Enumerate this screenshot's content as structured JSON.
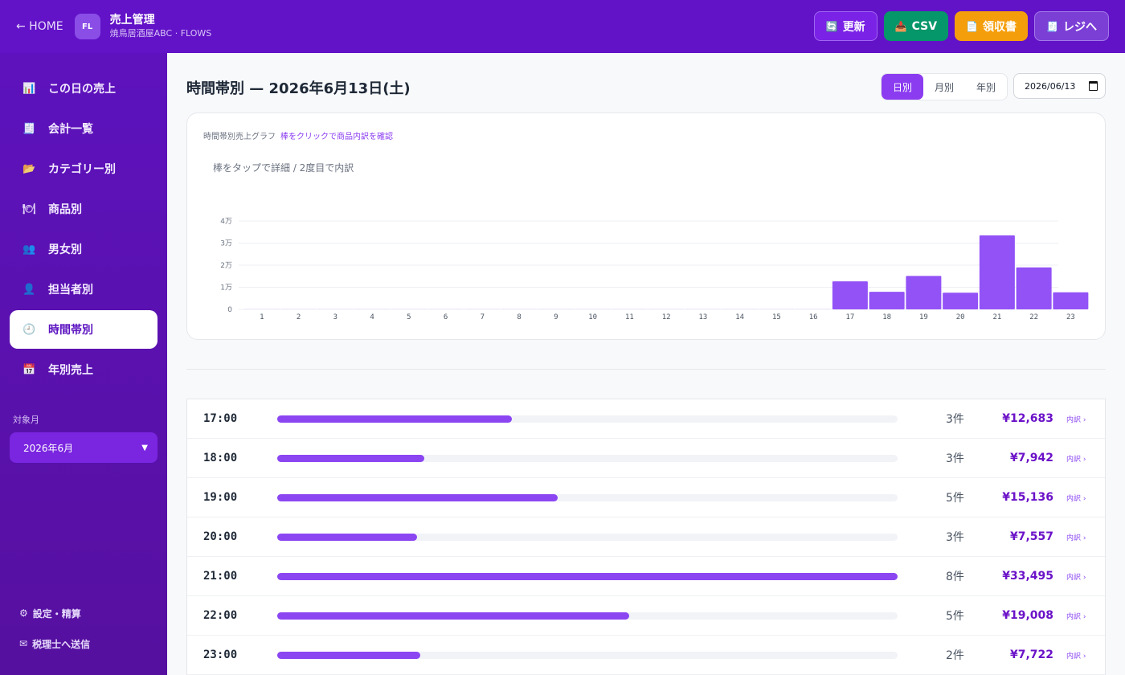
{
  "header": {
    "home_label": "← HOME",
    "logo_text": "FL",
    "title": "売上管理",
    "subtitle": "焼鳥居酒屋ABC · FLOWS",
    "buttons": {
      "refresh": {
        "icon": "🔄",
        "label": "更新"
      },
      "csv": {
        "icon": "📥",
        "label": "CSV"
      },
      "receipt": {
        "icon": "📄",
        "label": "領収書"
      },
      "register": {
        "icon": "🧾",
        "label": "レジへ"
      }
    }
  },
  "sidebar": {
    "items": [
      {
        "icon": "📊",
        "label": "この日の売上"
      },
      {
        "icon": "🧾",
        "label": "会計一覧"
      },
      {
        "icon": "📂",
        "label": "カテゴリー別"
      },
      {
        "icon": "🍽",
        "label": "商品別"
      },
      {
        "icon": "👥",
        "label": "男女別"
      },
      {
        "icon": "👤",
        "label": "担当者別"
      },
      {
        "icon": "🕘",
        "label": "時間帯別"
      },
      {
        "icon": "📅",
        "label": "年別売上"
      }
    ],
    "active_index": 6,
    "month_label": "対象月",
    "month_value": "2026年6月",
    "footer": [
      {
        "icon": "⚙",
        "label": "設定・精算"
      },
      {
        "icon": "✉",
        "label": "税理士へ送信"
      }
    ]
  },
  "main": {
    "title": "時間帯別 — 2026年6月13日(土)",
    "tabs": [
      "日別",
      "月別",
      "年別"
    ],
    "active_tab": 0,
    "date_value": "2026/06/13",
    "chart_heading": "時間帯別売上グラフ",
    "chart_hint": "棒をクリックで商品内訳を確認",
    "chart_note": "棒をタップで詳細 / 2度目で内訳",
    "detail_label": "内訳 ›",
    "rows": [
      {
        "time": "17:00",
        "count": "3件",
        "amount": "¥12,683",
        "value": 12683
      },
      {
        "time": "18:00",
        "count": "3件",
        "amount": "¥7,942",
        "value": 7942
      },
      {
        "time": "19:00",
        "count": "5件",
        "amount": "¥15,136",
        "value": 15136
      },
      {
        "time": "20:00",
        "count": "3件",
        "amount": "¥7,557",
        "value": 7557
      },
      {
        "time": "21:00",
        "count": "8件",
        "amount": "¥33,495",
        "value": 33495
      },
      {
        "time": "22:00",
        "count": "5件",
        "amount": "¥19,008",
        "value": 19008
      },
      {
        "time": "23:00",
        "count": "2件",
        "amount": "¥7,722",
        "value": 7722
      }
    ]
  },
  "colors": {
    "header_bg": "#6212c7",
    "accent": "#8b3cf0",
    "bar": "#8b46f2",
    "amount": "#6b12c8"
  },
  "chart_data": {
    "type": "bar",
    "categories": [
      "1",
      "2",
      "3",
      "4",
      "5",
      "6",
      "7",
      "8",
      "9",
      "10",
      "11",
      "12",
      "13",
      "14",
      "15",
      "16",
      "17",
      "18",
      "19",
      "20",
      "21",
      "22",
      "23"
    ],
    "values": [
      0,
      0,
      0,
      0,
      0,
      0,
      0,
      0,
      0,
      0,
      0,
      0,
      0,
      0,
      0,
      0,
      12683,
      7942,
      15136,
      7557,
      33495,
      19008,
      7722
    ],
    "ylim": [
      0,
      40000
    ],
    "yticks": [
      {
        "value": 0,
        "label": "0"
      },
      {
        "value": 10000,
        "label": "1万"
      },
      {
        "value": 20000,
        "label": "2万"
      },
      {
        "value": 30000,
        "label": "3万"
      },
      {
        "value": 40000,
        "label": "4万"
      }
    ],
    "grid": true
  }
}
